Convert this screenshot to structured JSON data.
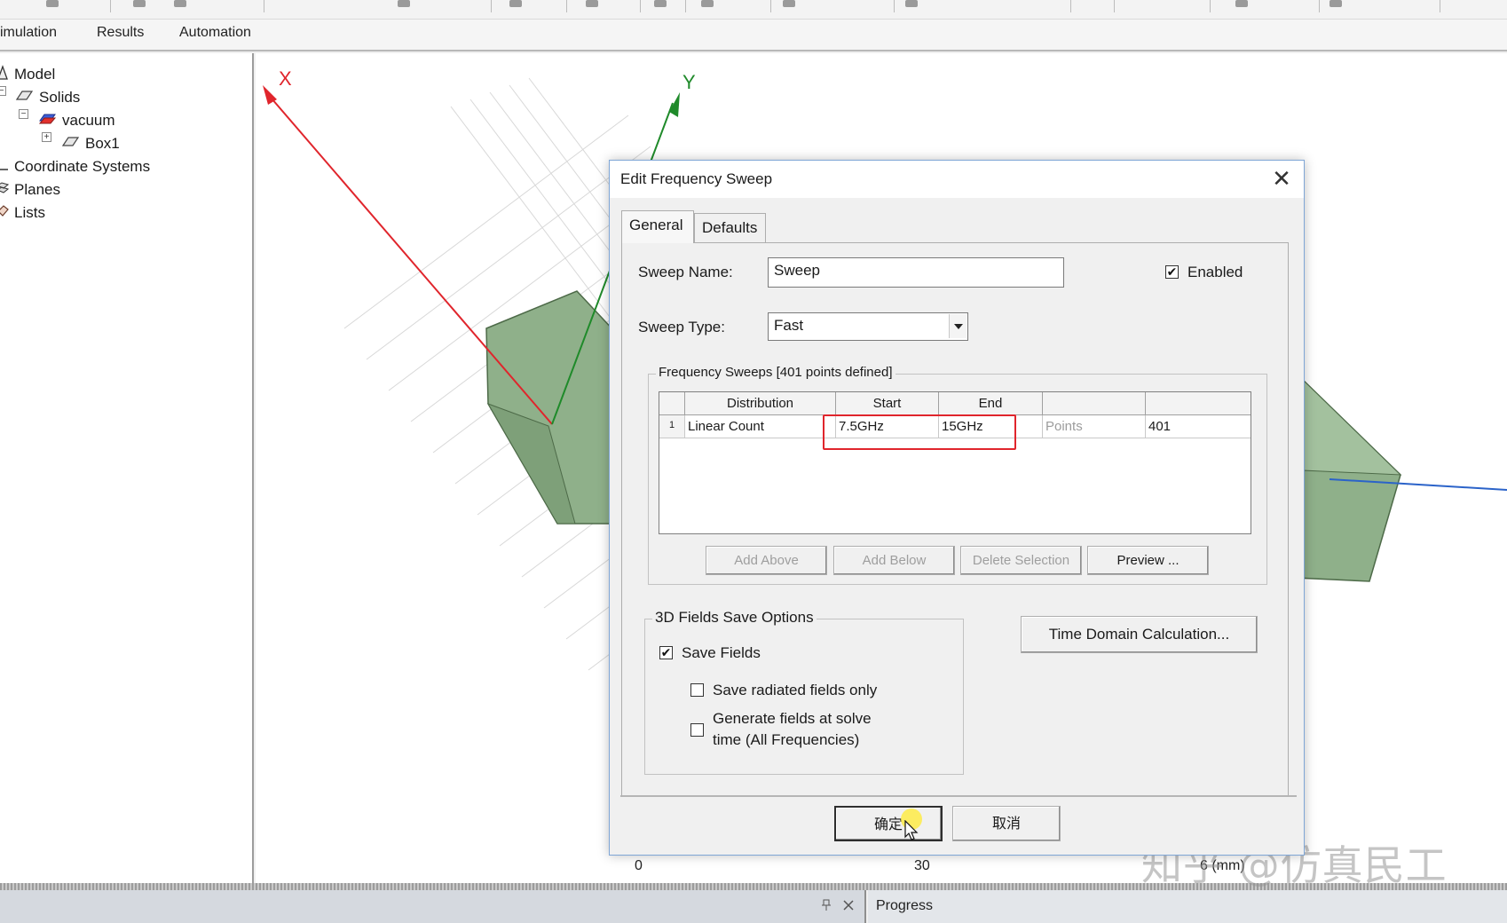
{
  "menu": {
    "items": [
      "imulation",
      "Results",
      "Automation"
    ]
  },
  "tree": {
    "model": "Model",
    "solids": "Solids",
    "vacuum": "vacuum",
    "box1": "Box1",
    "coordinate_systems": "Coordinate Systems",
    "planes": "Planes",
    "lists": "Lists"
  },
  "viewport": {
    "axis_x": "X",
    "axis_y": "Y",
    "ruler_0": "0",
    "ruler_30": "30",
    "ruler_unit": "6 (mm)"
  },
  "dialog": {
    "title": "Edit Frequency Sweep",
    "close": "✕",
    "tabs": [
      "General",
      "Defaults"
    ],
    "sweep_name_label": "Sweep Name:",
    "sweep_name_value": "Sweep",
    "enabled_label": "Enabled",
    "enabled_checked": true,
    "sweep_type_label": "Sweep Type:",
    "sweep_type_value": "Fast",
    "freq_group_title": "Frequency Sweeps [401 points defined]",
    "grid": {
      "headers": [
        "",
        "Distribution",
        "Start",
        "End",
        "",
        ""
      ],
      "rows": [
        {
          "index": "1",
          "distribution": "Linear Count",
          "start": "7.5GHz",
          "end": "15GHz",
          "points_label": "Points",
          "points": "401"
        }
      ]
    },
    "grid_buttons": {
      "add_above": "Add Above",
      "add_below": "Add Below",
      "delete_selection": "Delete Selection",
      "preview": "Preview ..."
    },
    "fields_group_title": "3D Fields Save Options",
    "save_fields_label": "Save Fields",
    "save_fields_checked": true,
    "save_radiated_label": "Save radiated fields only",
    "generate_fields_label_1": "Generate fields at solve",
    "generate_fields_label_2": "time (All Frequencies)",
    "time_domain_button": "Time Domain Calculation...",
    "ok_button": "确定",
    "cancel_button": "取消"
  },
  "bottom": {
    "pin_icon": "pin-icon",
    "close_icon": "close-icon",
    "progress_label": "Progress"
  },
  "watermark": "知乎 @仿真民工",
  "colors": {
    "axis_x": "#e0252c",
    "axis_y": "#1f8a2a",
    "axis_z": "#2b63c9",
    "box_fill": "#8fb08a",
    "highlight": "#e0252c",
    "dialog_border": "#7fa6d6"
  }
}
